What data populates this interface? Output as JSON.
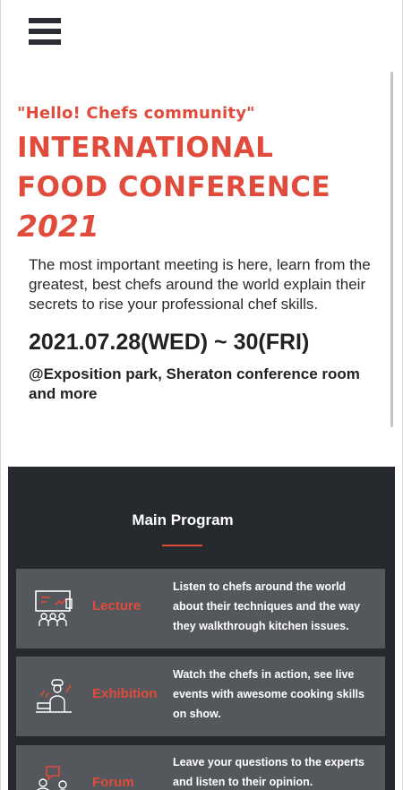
{
  "header": {
    "menu_icon": "hamburger-menu-icon"
  },
  "hero": {
    "tagline": "\"Hello! Chefs community\"",
    "title_line1": "INTERNATIONAL",
    "title_line2": "FOOD CONFERENCE",
    "year": "2021",
    "description": "The most important meeting is here, learn from the greatest, best chefs around the world explain their secrets to rise your professional chef skills.",
    "dates": "2021.07.28(WED) ~ 30(FRI)",
    "venue": "@Exposition park, Sheraton conference room and more"
  },
  "program": {
    "title": "Main Program",
    "items": [
      {
        "label": "Lecture",
        "icon": "lecture-chef-board-icon",
        "text": "Listen to chefs around the world about their techniques and the way they walkthrough kitchen issues."
      },
      {
        "label": "Exhibition",
        "icon": "exhibition-chef-cooking-icon",
        "text": "Watch the chefs in action, see live events with awesome cooking skills on show."
      },
      {
        "label": "Forum",
        "icon": "forum-chef-discussion-icon",
        "text": "Leave your questions to the experts and listen to their opinion."
      }
    ]
  },
  "colors": {
    "accent": "#e14b3b",
    "program_bg": "#26292e",
    "card_bg": "#54575c"
  }
}
